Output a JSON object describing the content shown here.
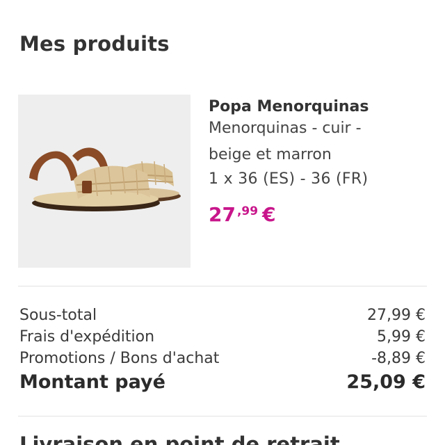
{
  "products_section": {
    "title": "Mes produits"
  },
  "product": {
    "image_alt": "sandal-photo",
    "name": "Popa Menorquinas",
    "description_line1": "Menorquinas - cuir -",
    "description_line2": "beige et marron",
    "quantity_size": "1 x 36 (ES) - 36 (FR)",
    "price_whole": "27",
    "price_cents": ",99",
    "price_currency": "€"
  },
  "summary": {
    "rows": [
      {
        "label": "Sous-total",
        "value": "27,99 €"
      },
      {
        "label": "Frais d'expédition",
        "value": "5,99 €"
      },
      {
        "label": "Promotions / Bons d'achat",
        "value": "-8,89 €"
      }
    ],
    "total_label": "Montant payé",
    "total_value": "25,09 €"
  },
  "next_section": {
    "title": "Livraison en point de retrait"
  },
  "colors": {
    "price": "#c8168b",
    "divider": "#e2e2e2",
    "image_background": "#eeeeee"
  }
}
